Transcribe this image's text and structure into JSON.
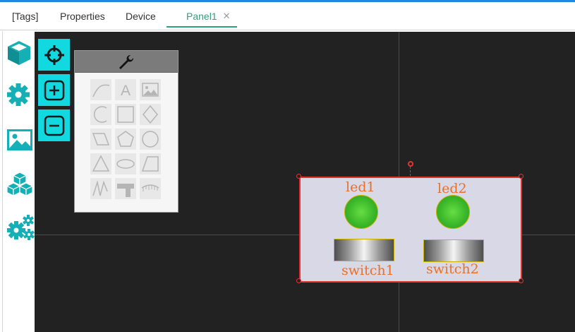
{
  "tabs": [
    {
      "label": "[Tags]",
      "active": false
    },
    {
      "label": "Properties",
      "active": false
    },
    {
      "label": "Device",
      "active": false
    },
    {
      "label": "Panel1",
      "active": true,
      "closable": true
    }
  ],
  "tab_close_glyph": "✕",
  "accent_color": "#2aa37a",
  "left_toolbar": [
    {
      "icon": "cube-icon"
    },
    {
      "icon": "gear-icon"
    },
    {
      "icon": "image-icon"
    },
    {
      "icon": "cubes-icon"
    },
    {
      "icon": "gears-icon"
    }
  ],
  "canvas_tools": [
    {
      "icon": "crosshair-icon"
    },
    {
      "icon": "zoom-in-icon"
    },
    {
      "icon": "zoom-out-icon"
    }
  ],
  "palette": {
    "header_icon": "wrench-icon",
    "items": [
      "curve",
      "text",
      "image",
      "arc",
      "rectangle",
      "diamond",
      "parallelogram",
      "pentagon",
      "circle",
      "triangle",
      "ellipse",
      "trapezoid",
      "polyline",
      "pipe",
      "ruler"
    ],
    "text_glyph": "A"
  },
  "panel": {
    "leds": [
      {
        "label": "led1"
      },
      {
        "label": "led2"
      }
    ],
    "switches": [
      {
        "label": "switch1"
      },
      {
        "label": "switch2"
      }
    ]
  }
}
